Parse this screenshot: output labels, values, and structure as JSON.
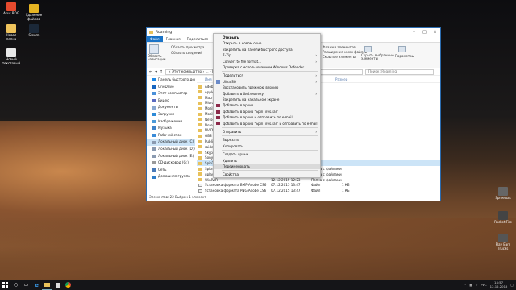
{
  "desktop": {
    "icons_left": [
      {
        "label": "Asus ROG",
        "color": "#e64a2e"
      },
      {
        "label": "Удаление файлов",
        "color": "#e6b422"
      },
      {
        "label": "Новая папка",
        "color": "#f0c45c"
      },
      {
        "label": "Steam",
        "color": "#1b2838"
      },
      {
        "label": "Новый текстовый",
        "color": "#e8e8e8"
      }
    ],
    "icons_right": [
      {
        "label": "Spreewas",
        "color": "#666"
      },
      {
        "label": "Rocket Fire",
        "color": "#444"
      },
      {
        "label": "Play Earn Trucks",
        "color": "#555"
      }
    ]
  },
  "window": {
    "title": "Roaming",
    "tabs": [
      "Файл",
      "Главная",
      "Поделиться",
      "Вид"
    ],
    "ribbon": {
      "pane": "Область\nнавигации",
      "preview": "Область просмотра",
      "details": "Область сведений",
      "hidden_items": "Флажки элементов",
      "file_ext": "Расширения имен файлов",
      "hidden": "Скрытые элементы",
      "hide_selected": "Скрыть выбранные\nэлементы",
      "params": "Параметры"
    },
    "address": "« Этот компьютер › ... › Roaming",
    "search_placeholder": "Поиск: Roaming",
    "nav": [
      {
        "label": "Панель быстрого доступа",
        "color": "#1e88e5"
      },
      {
        "label": "OneDrive",
        "color": "#1565c0"
      },
      {
        "label": "Этот компьютер",
        "color": "#4a90d9"
      },
      {
        "label": "Видео",
        "color": "#5a6ac0"
      },
      {
        "label": "Документы",
        "color": "#8aa8d0"
      },
      {
        "label": "Загрузки",
        "color": "#2e8bd8"
      },
      {
        "label": "Изображения",
        "color": "#4c9ad8"
      },
      {
        "label": "Музыка",
        "color": "#3f82c8"
      },
      {
        "label": "Рабочий стол",
        "color": "#3a8bd8"
      },
      {
        "label": "Локальный диск (C:)",
        "color": "#8a9ab0"
      },
      {
        "label": "Локальный диск (D:)",
        "color": "#8a9ab0"
      },
      {
        "label": "Локальный диск (E:)",
        "color": "#8a9ab0"
      },
      {
        "label": "CD-дисковод (G:)",
        "color": "#9a9a9a"
      },
      {
        "label": "Сеть",
        "color": "#4a7ab8"
      },
      {
        "label": "Домашняя группа",
        "color": "#2e7dc9"
      }
    ],
    "columns": [
      "Имя",
      "Дата изменения",
      "Тип",
      "Размер"
    ],
    "files": [
      {
        "name": "Adobe",
        "date": "",
        "type": "",
        "size": ""
      },
      {
        "name": "Apple",
        "date": "",
        "type": "",
        "size": ""
      },
      {
        "name": "Macro",
        "date": "",
        "type": "",
        "size": ""
      },
      {
        "name": "Micro",
        "date": "",
        "type": "",
        "size": ""
      },
      {
        "name": "Mozil",
        "date": "",
        "type": "",
        "size": ""
      },
      {
        "name": "Mozil",
        "date": "",
        "type": "",
        "size": ""
      },
      {
        "name": "Netsc",
        "date": "",
        "type": "",
        "size": ""
      },
      {
        "name": "Notep",
        "date": "",
        "type": "",
        "size": ""
      },
      {
        "name": "NVIDI",
        "date": "",
        "type": "",
        "size": ""
      },
      {
        "name": "OBS",
        "date": "",
        "type": "",
        "size": ""
      },
      {
        "name": "Publis",
        "date": "",
        "type": "",
        "size": ""
      },
      {
        "name": "raidca",
        "date": "",
        "type": "",
        "size": ""
      },
      {
        "name": "Skype",
        "date": "",
        "type": "",
        "size": ""
      },
      {
        "name": "Sony",
        "date": "",
        "type": "",
        "size": ""
      },
      {
        "name": "SpinTires",
        "date": "",
        "type": "",
        "size": ""
      },
      {
        "name": "Spltmediaid.sbo",
        "date": "07.12.2015 13:34",
        "type": "Папка с файлами",
        "size": ""
      },
      {
        "name": "uplay",
        "date": "07.12.2015 17:50",
        "type": "Папка с файлами",
        "size": ""
      },
      {
        "name": "WinRAR",
        "date": "12.12.2015 12:23",
        "type": "Папка с файлами",
        "size": ""
      },
      {
        "name": "Установка формата BMP Adobe CS6",
        "date": "07.12.2015 13:47",
        "type": "Файл",
        "size": "1 КБ"
      },
      {
        "name": "Установка формата PNG Adobe CS6",
        "date": "07.12.2015 13:47",
        "type": "Файл",
        "size": "1 КБ"
      }
    ],
    "status": "Элементов: 22    Выбран 1 элемент"
  },
  "menu": {
    "items": [
      {
        "label": "Открыть",
        "bold": true
      },
      {
        "label": "Открыть в новом окне"
      },
      {
        "label": "Закрепить на панели быстрого доступа"
      },
      {
        "label": "7-Zip",
        "arrow": true
      },
      {
        "label": "Convert to file format...",
        "arrow": true
      },
      {
        "label": "Проверка с использованием Windows Defender..."
      },
      {
        "sep": true
      },
      {
        "label": "Поделиться",
        "arrow": true
      },
      {
        "label": "UltraISO",
        "arrow": true,
        "icon": "#6a8ac8"
      },
      {
        "label": "Восстановить прежнюю версию"
      },
      {
        "label": "Добавить в библиотеку",
        "arrow": true
      },
      {
        "label": "Закрепить на начальном экране"
      },
      {
        "label": "Добавить в архив...",
        "icon": "#8b2a4a"
      },
      {
        "label": "Добавить в архив \"SpinTires.rar\"",
        "icon": "#8b2a4a"
      },
      {
        "label": "Добавить в архив и отправить по e-mail...",
        "icon": "#8b2a4a"
      },
      {
        "label": "Добавить в архив \"SpinTires.rar\" и отправить по e-mail",
        "icon": "#8b2a4a"
      },
      {
        "sep": true
      },
      {
        "label": "Отправить",
        "arrow": true
      },
      {
        "sep": true
      },
      {
        "label": "Вырезать"
      },
      {
        "label": "Копировать"
      },
      {
        "sep": true
      },
      {
        "label": "Создать ярлык"
      },
      {
        "label": "Удалить"
      },
      {
        "label": "Переименовать",
        "highlight": true
      },
      {
        "sep": true
      },
      {
        "label": "Свойства"
      }
    ]
  },
  "taskbar": {
    "lang": "РУС",
    "time": "14:57",
    "date": "12.12.2015"
  }
}
